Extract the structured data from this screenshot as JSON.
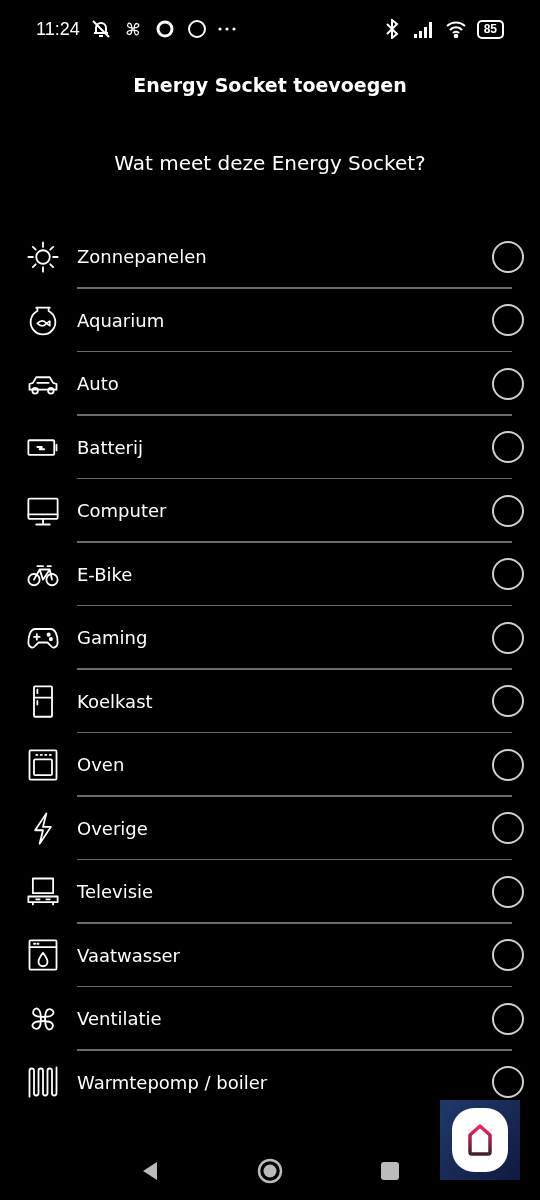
{
  "status_bar": {
    "time": "11:24",
    "battery": "85"
  },
  "title": "Energy Socket toevoegen",
  "question": "Wat meet deze Energy Socket?",
  "options": [
    {
      "kind": "sun",
      "label": "Zonnepanelen",
      "selected": false
    },
    {
      "kind": "fishbowl",
      "label": "Aquarium",
      "selected": false
    },
    {
      "kind": "car",
      "label": "Auto",
      "selected": false
    },
    {
      "kind": "battery",
      "label": "Batterij",
      "selected": false
    },
    {
      "kind": "computer",
      "label": "Computer",
      "selected": false
    },
    {
      "kind": "bike",
      "label": "E-Bike",
      "selected": false
    },
    {
      "kind": "gamepad",
      "label": "Gaming",
      "selected": false
    },
    {
      "kind": "fridge",
      "label": "Koelkast",
      "selected": false
    },
    {
      "kind": "oven",
      "label": "Oven",
      "selected": false
    },
    {
      "kind": "bolt",
      "label": "Overige",
      "selected": false
    },
    {
      "kind": "tv",
      "label": "Televisie",
      "selected": false
    },
    {
      "kind": "dishwasher",
      "label": "Vaatwasser",
      "selected": false
    },
    {
      "kind": "fan",
      "label": "Ventilatie",
      "selected": false
    },
    {
      "kind": "heater",
      "label": "Warmtepomp / boiler",
      "selected": false
    }
  ]
}
